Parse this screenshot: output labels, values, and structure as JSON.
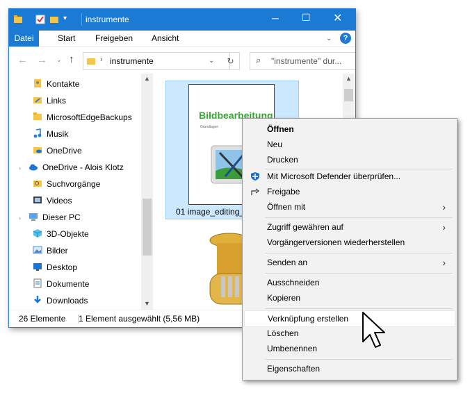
{
  "window": {
    "title": "instrumente",
    "ribbon_tabs": [
      "Datei",
      "Start",
      "Freigeben",
      "Ansicht"
    ],
    "address": "instrumente",
    "search_placeholder": "\"instrumente\" dur...",
    "nav_items": [
      {
        "label": "Kontakte",
        "icon": "contacts-icon"
      },
      {
        "label": "Links",
        "icon": "links-icon"
      },
      {
        "label": "MicrosoftEdgeBackups",
        "icon": "folder-icon"
      },
      {
        "label": "Musik",
        "icon": "music-icon"
      },
      {
        "label": "OneDrive",
        "icon": "folder-icon"
      },
      {
        "label": "OneDrive - Alois Klotz",
        "icon": "cloud-icon"
      },
      {
        "label": "Suchvorgänge",
        "icon": "search-folder-icon"
      },
      {
        "label": "Videos",
        "icon": "videos-icon"
      },
      {
        "label": "Dieser PC",
        "icon": "pc-icon"
      },
      {
        "label": "3D-Objekte",
        "icon": "3d-objects-icon"
      },
      {
        "label": "Bilder",
        "icon": "pictures-icon"
      },
      {
        "label": "Desktop",
        "icon": "desktop-icon"
      },
      {
        "label": "Dokumente",
        "icon": "documents-icon"
      },
      {
        "label": "Downloads",
        "icon": "downloads-icon"
      }
    ],
    "file1": {
      "name": "01 image_editing_",
      "doc_title": "Bildbearbeitung",
      "doc_subtitle": "Grundlagen"
    },
    "status": {
      "count": "26 Elemente",
      "selection": "1 Element ausgewählt (5,56 MB)"
    }
  },
  "menu": {
    "items": [
      {
        "label": "Öffnen",
        "bold": true
      },
      {
        "label": "Neu"
      },
      {
        "label": "Drucken"
      },
      {
        "label": "Mit Microsoft Defender überprüfen...",
        "icon": "defender-icon"
      },
      {
        "label": "Freigabe",
        "icon": "share-icon"
      },
      {
        "label": "Öffnen mit",
        "submenu": true
      },
      {
        "label": "Zugriff gewähren auf",
        "submenu": true
      },
      {
        "label": "Vorgängerversionen wiederherstellen"
      },
      {
        "label": "Senden an",
        "submenu": true
      },
      {
        "label": "Ausschneiden"
      },
      {
        "label": "Kopieren"
      },
      {
        "label": "Verknüpfung erstellen"
      },
      {
        "label": "Löschen"
      },
      {
        "label": "Umbenennen"
      },
      {
        "label": "Eigenschaften"
      }
    ]
  },
  "colors": {
    "accent": "#1a7ad4",
    "doc_title_green": "#3aa635",
    "folder_yellow": "#f3c64b"
  }
}
